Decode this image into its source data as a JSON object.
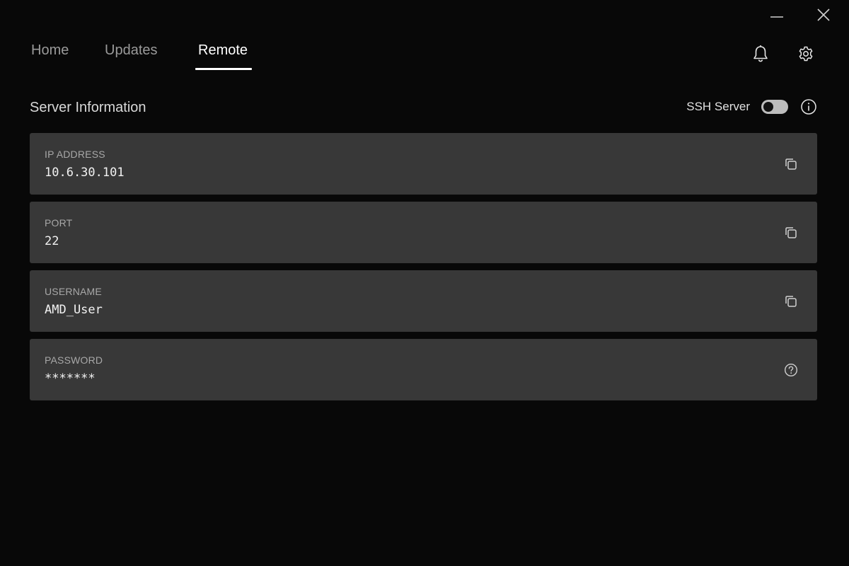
{
  "window": {
    "minimize_icon": "minimize-icon",
    "close_icon": "close-icon"
  },
  "tabs": [
    {
      "label": "Home",
      "active": false
    },
    {
      "label": "Updates",
      "active": false
    },
    {
      "label": "Remote",
      "active": true
    }
  ],
  "header": {
    "notifications_icon": "bell-icon",
    "settings_icon": "gear-icon"
  },
  "section": {
    "title": "Server Information",
    "ssh_label": "SSH Server",
    "ssh_enabled": false,
    "info_icon": "info-icon"
  },
  "fields": [
    {
      "label": "IP ADDRESS",
      "value": "10.6.30.101",
      "action_icon": "copy-icon"
    },
    {
      "label": "PORT",
      "value": "22",
      "action_icon": "copy-icon"
    },
    {
      "label": "USERNAME",
      "value": "AMD_User",
      "action_icon": "copy-icon"
    },
    {
      "label": "PASSWORD",
      "value": "*******",
      "action_icon": "help-icon"
    }
  ],
  "colors": {
    "background": "#080808",
    "card": "#383838",
    "active_tab": "#ffffff",
    "inactive_tab": "#9a9a9a"
  }
}
